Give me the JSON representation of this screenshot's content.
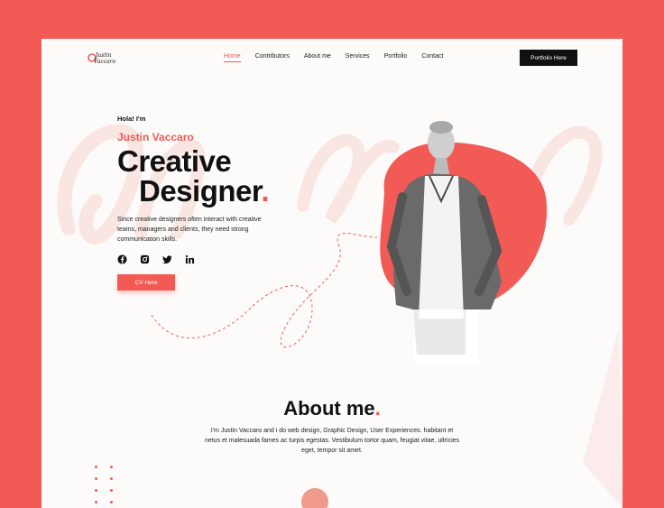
{
  "brand": {
    "logo_text_line1": "Justin",
    "logo_text_line2": "Vaccaro",
    "accent_color": "#f25a55",
    "page_background": "#f25a55"
  },
  "nav": {
    "items": [
      {
        "label": "Home",
        "active": true
      },
      {
        "label": "Contributors",
        "active": false
      },
      {
        "label": "About me",
        "active": false
      },
      {
        "label": "Services",
        "active": false
      },
      {
        "label": "Portfolio",
        "active": false
      },
      {
        "label": "Contact",
        "active": false
      }
    ],
    "cta_label": "Portfolio Here"
  },
  "hero": {
    "greeting": "Hola! I'm",
    "name": "Justin Vaccaro",
    "headline_line1": "Creative",
    "headline_line2": "Designer",
    "headline_dot": ".",
    "description": "Since creative designers often interact with creative teams, managers and clients, they need strong communication skills.",
    "socials": [
      "facebook-icon",
      "instagram-icon",
      "twitter-icon",
      "linkedin-icon"
    ],
    "cv_button_label": "CV Here"
  },
  "about": {
    "title": "About me",
    "title_dot": ".",
    "text": "I'm Justin Vaccaro and i do web design, Graphic Design, User Experiences. habitant et netus et malesuada fames ac turpis egestas. Vestibulum tortor quam, feugiat vitae, ultricies eget, tempor sit amet."
  }
}
